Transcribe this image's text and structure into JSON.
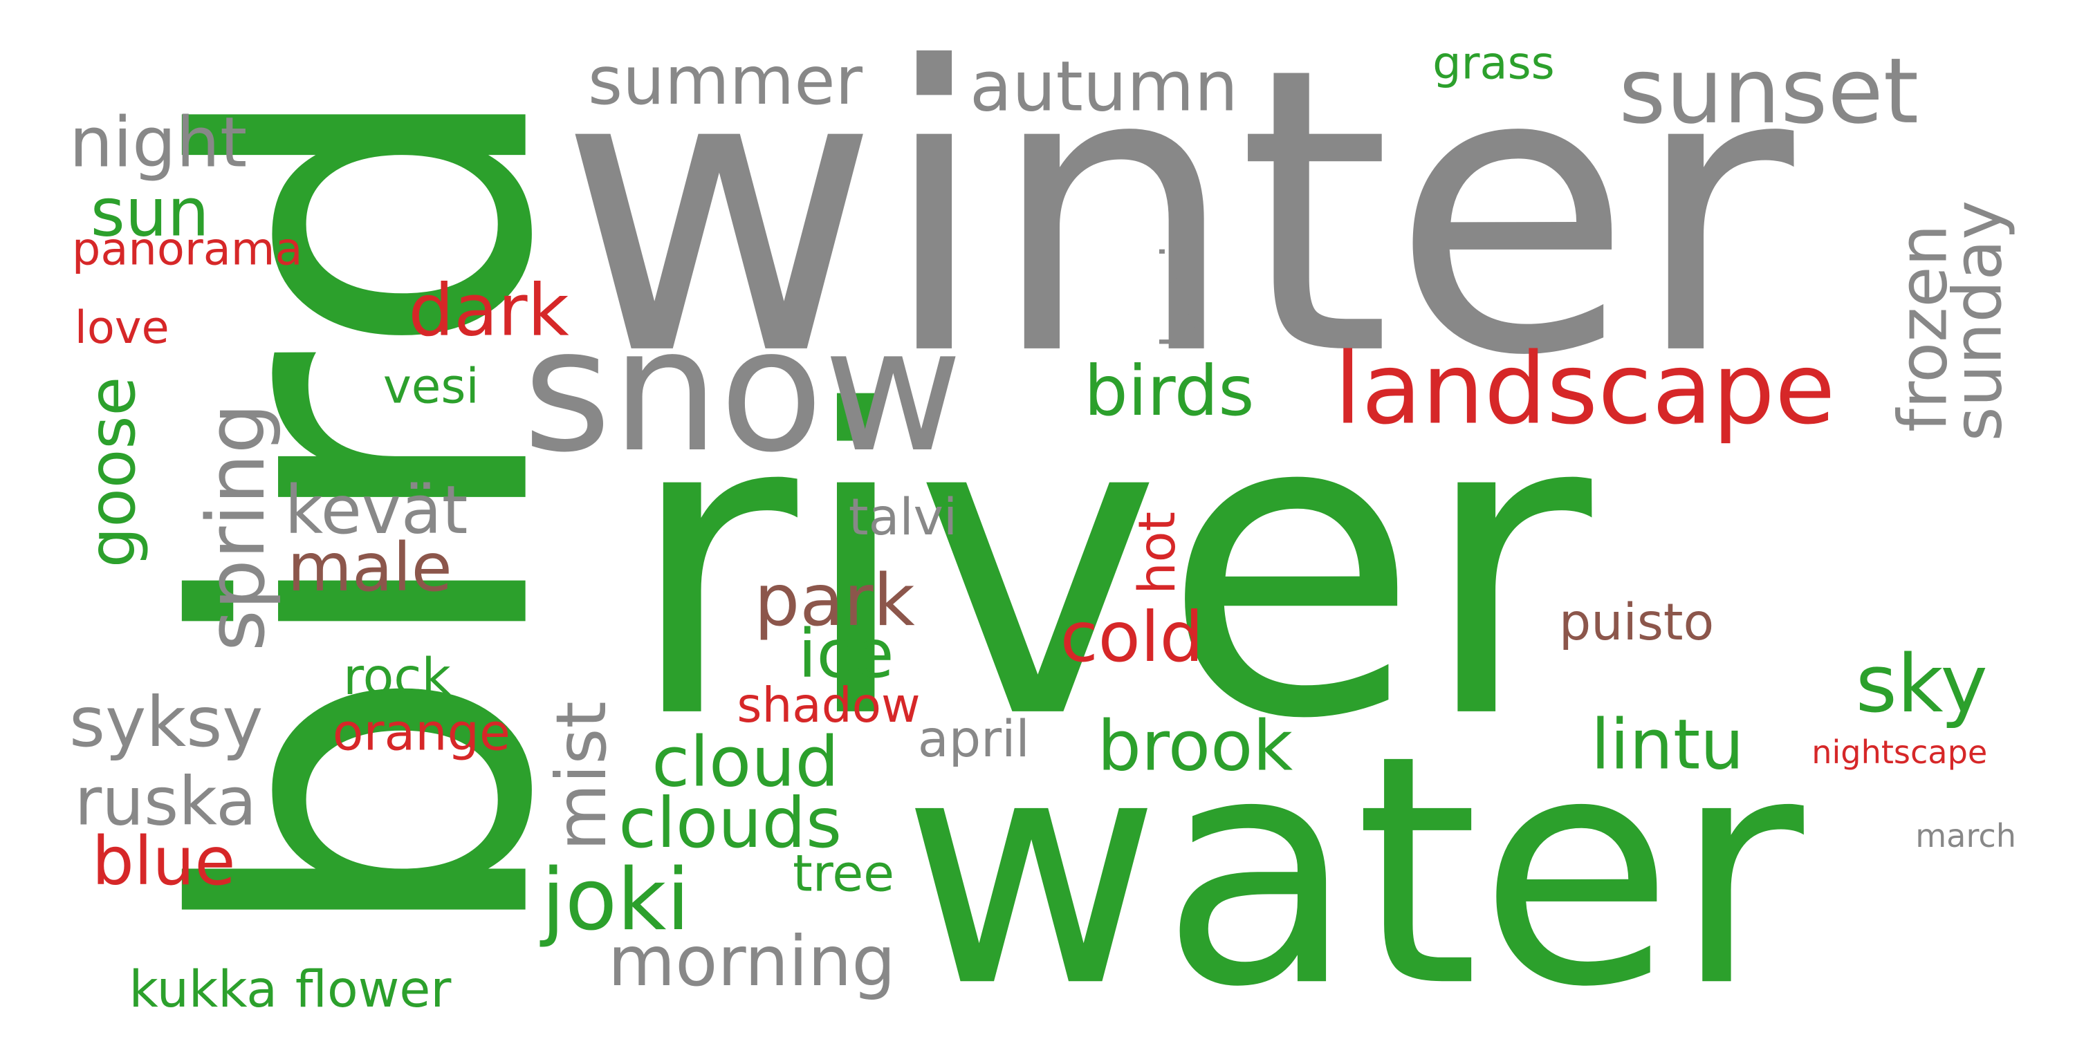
{
  "palette": {
    "green": "#2ca02c",
    "gray": "#888888",
    "red": "#d62728",
    "brown": "#8c564b"
  },
  "words": [
    {
      "key": "bird",
      "text": "bird",
      "color": "green"
    },
    {
      "key": "winter",
      "text": "winter",
      "color": "gray"
    },
    {
      "key": "river",
      "text": "river",
      "color": "green"
    },
    {
      "key": "water",
      "text": "water",
      "color": "green"
    },
    {
      "key": "snow",
      "text": "snow",
      "color": "gray"
    },
    {
      "key": "landscape",
      "text": "landscape",
      "color": "red"
    },
    {
      "key": "sunset",
      "text": "sunset",
      "color": "gray"
    },
    {
      "key": "summer",
      "text": "summer",
      "color": "gray"
    },
    {
      "key": "autumn",
      "text": "autumn",
      "color": "gray"
    },
    {
      "key": "grass",
      "text": "grass",
      "color": "green"
    },
    {
      "key": "night",
      "text": "night",
      "color": "gray"
    },
    {
      "key": "sun",
      "text": "sun",
      "color": "green"
    },
    {
      "key": "panorama",
      "text": "panorama",
      "color": "red"
    },
    {
      "key": "love",
      "text": "love",
      "color": "red"
    },
    {
      "key": "goose",
      "text": "goose",
      "color": "green"
    },
    {
      "key": "spring",
      "text": "spring",
      "color": "gray"
    },
    {
      "key": "dark",
      "text": "dark",
      "color": "red"
    },
    {
      "key": "vesi",
      "text": "vesi",
      "color": "green"
    },
    {
      "key": "birds",
      "text": "birds",
      "color": "green"
    },
    {
      "key": "lumi",
      "text": "lumi",
      "color": "gray"
    },
    {
      "key": "frozen",
      "text": "frozen",
      "color": "gray"
    },
    {
      "key": "sunday",
      "text": "sunday",
      "color": "gray"
    },
    {
      "key": "kevat",
      "text": "kevät",
      "color": "gray"
    },
    {
      "key": "male",
      "text": "male",
      "color": "brown"
    },
    {
      "key": "talvi",
      "text": "talvi",
      "color": "gray"
    },
    {
      "key": "hot",
      "text": "hot",
      "color": "red"
    },
    {
      "key": "park",
      "text": "park",
      "color": "brown"
    },
    {
      "key": "cold",
      "text": "cold",
      "color": "red"
    },
    {
      "key": "ice",
      "text": "ice",
      "color": "green"
    },
    {
      "key": "puisto",
      "text": "puisto",
      "color": "brown"
    },
    {
      "key": "sky",
      "text": "sky",
      "color": "green"
    },
    {
      "key": "syksy",
      "text": "syksy",
      "color": "gray"
    },
    {
      "key": "rock",
      "text": "rock",
      "color": "green"
    },
    {
      "key": "orange",
      "text": "orange",
      "color": "red"
    },
    {
      "key": "mist",
      "text": "mist",
      "color": "gray"
    },
    {
      "key": "shadow",
      "text": "shadow",
      "color": "red"
    },
    {
      "key": "cloud",
      "text": "cloud",
      "color": "green"
    },
    {
      "key": "april",
      "text": "april",
      "color": "gray"
    },
    {
      "key": "brook",
      "text": "brook",
      "color": "green"
    },
    {
      "key": "lintu",
      "text": "lintu",
      "color": "green"
    },
    {
      "key": "nightscape",
      "text": "nightscape",
      "color": "red"
    },
    {
      "key": "ruska",
      "text": "ruska",
      "color": "gray"
    },
    {
      "key": "clouds",
      "text": "clouds",
      "color": "green"
    },
    {
      "key": "blue",
      "text": "blue",
      "color": "red"
    },
    {
      "key": "joki",
      "text": "joki",
      "color": "green"
    },
    {
      "key": "tree",
      "text": "tree",
      "color": "green"
    },
    {
      "key": "march",
      "text": "march",
      "color": "gray"
    },
    {
      "key": "morning",
      "text": "morning",
      "color": "gray"
    },
    {
      "key": "kukka",
      "text": "kukka",
      "color": "green"
    },
    {
      "key": "flower",
      "text": "flower",
      "color": "green"
    }
  ]
}
